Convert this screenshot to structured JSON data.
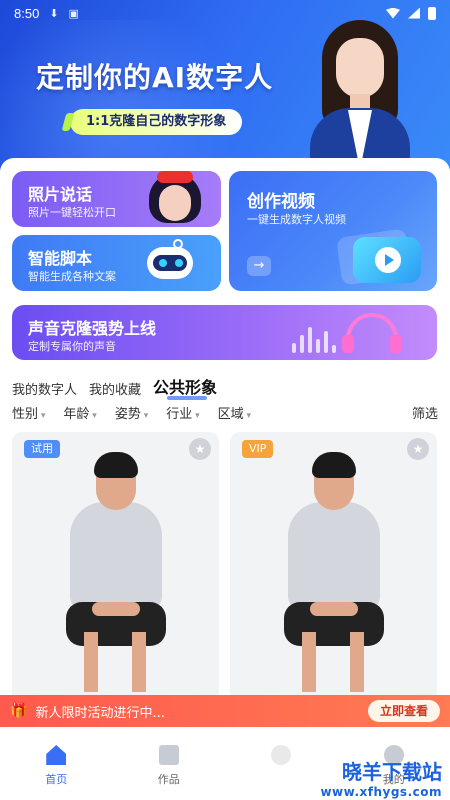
{
  "status_bar": {
    "time": "8:50"
  },
  "banner": {
    "title": "定制你的AI数字人",
    "subtitle": "1:1克隆自己的数字形象"
  },
  "features": {
    "photo": {
      "title": "照片说话",
      "subtitle": "照片一键轻松开口"
    },
    "script": {
      "title": "智能脚本",
      "subtitle": "智能生成各种文案"
    },
    "video": {
      "title": "创作视频",
      "subtitle": "一键生成数字人视频",
      "arrow": "→"
    },
    "voice": {
      "title": "声音克隆强势上线",
      "subtitle": "定制专属你的声音"
    }
  },
  "tabs": [
    "我的数字人",
    "我的收藏",
    "公共形象"
  ],
  "active_tab": "公共形象",
  "filters": {
    "items": [
      "性别",
      "年龄",
      "姿势",
      "行业",
      "区域"
    ],
    "right": "筛选"
  },
  "avatars": [
    {
      "tag": "试用",
      "favorite_icon": "star-icon"
    },
    {
      "tag": "VIP",
      "favorite_icon": "star-icon"
    }
  ],
  "promo": {
    "text": "新人限时活动进行中...",
    "button": "立即查看"
  },
  "bottom_nav": {
    "home": "首页",
    "works": "作品",
    "mine": "我的"
  },
  "watermark": {
    "title": "晓羊下载站",
    "url": "www.xfhygs.com"
  },
  "colors": {
    "accent": "#3b6ef6",
    "promo": "#ff5a4e",
    "vip": "#f5a33b",
    "trial": "#4f8ef7"
  }
}
